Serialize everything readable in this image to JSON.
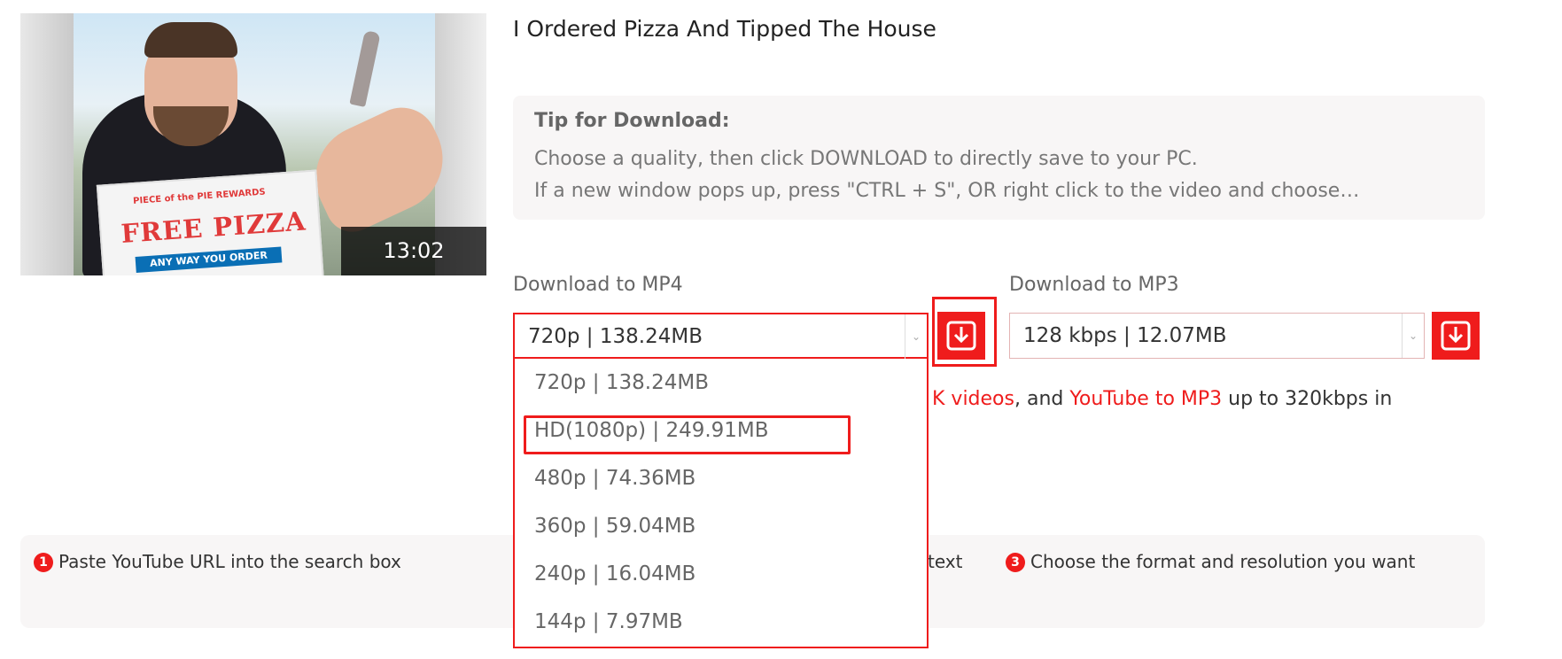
{
  "video": {
    "title": "I Ordered Pizza And Tipped The House",
    "duration": "13:02",
    "thumbnail_box_texts": [
      "PIECE of the PIE REWARDS",
      "FREE PIZZA",
      "ANY WAY YOU ORDER"
    ]
  },
  "tip": {
    "heading": "Tip for Download:",
    "line1": "Choose a quality, then click DOWNLOAD to directly save to your PC.",
    "line2": "If a new window pops up, press \"CTRL + S\", OR right click to the video and choose…"
  },
  "mp4": {
    "label": "Download to MP4",
    "selected": "720p | 138.24MB",
    "options": [
      "720p | 138.24MB",
      "HD(1080p) | 249.91MB",
      "480p | 74.36MB",
      "360p | 59.04MB",
      "240p | 16.04MB",
      "144p | 7.97MB"
    ]
  },
  "mp3": {
    "label": "Download to MP3",
    "selected": "128 kbps | 12.07MB"
  },
  "promo": {
    "part1": "K videos",
    "part2": ", and ",
    "part3": "YouTube to MP3",
    "part4": " up to 320kbps in"
  },
  "steps": [
    {
      "num": "1",
      "text": "Paste YouTube URL into the search box"
    },
    {
      "num": "",
      "text": "text"
    },
    {
      "num": "3",
      "text": "Choose the format and resolution you want"
    }
  ],
  "icons": {
    "download": "download-icon",
    "dropdown_arrow": "chevron-down-icon"
  },
  "colors": {
    "accent": "#ef1c1c",
    "tip_bg": "#f8f6f6"
  }
}
